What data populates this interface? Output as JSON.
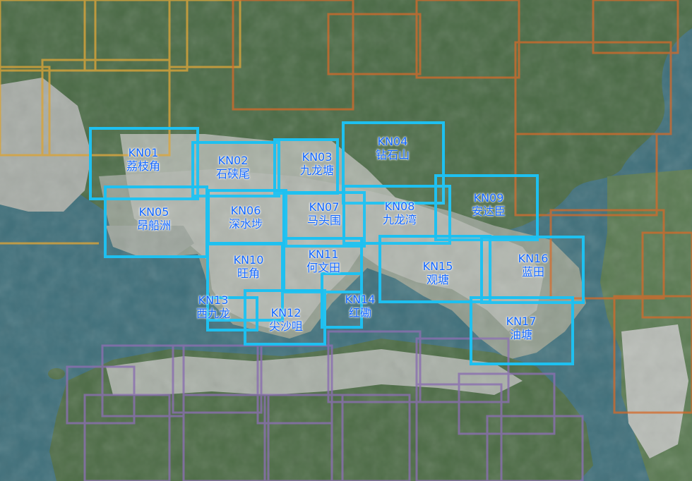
{
  "map": {
    "colors": {
      "water": "#3f6f7a",
      "land": "#4a6a45",
      "urban": "#aab0ab",
      "kowloon_tiles": "#1ec0f0",
      "label_text": "#1166ff",
      "nt_west_grid": "#d9a43a",
      "nt_east_grid": "#d46a2a",
      "hk_island_grid": "#8a6fb0"
    },
    "zones": [
      {
        "code": "KN01",
        "name": "荔枝角"
      },
      {
        "code": "KN02",
        "name": "石硖尾"
      },
      {
        "code": "KN03",
        "name": "九龙塘"
      },
      {
        "code": "KN04",
        "name": "钻石山"
      },
      {
        "code": "KN05",
        "name": "昂船洲"
      },
      {
        "code": "KN06",
        "name": "深水埗"
      },
      {
        "code": "KN07",
        "name": "马头围"
      },
      {
        "code": "KN08",
        "name": "九龙湾"
      },
      {
        "code": "KN09",
        "name": "安达臣"
      },
      {
        "code": "KN10",
        "name": "旺角"
      },
      {
        "code": "KN11",
        "name": "何文田"
      },
      {
        "code": "KN12",
        "name": "尖沙咀"
      },
      {
        "code": "KN13",
        "name": "西九龙"
      },
      {
        "code": "KN14",
        "name": "红磡"
      },
      {
        "code": "KN15",
        "name": "观塘"
      },
      {
        "code": "KN16",
        "name": "蓝田"
      },
      {
        "code": "KN17",
        "name": "油塘"
      }
    ]
  }
}
